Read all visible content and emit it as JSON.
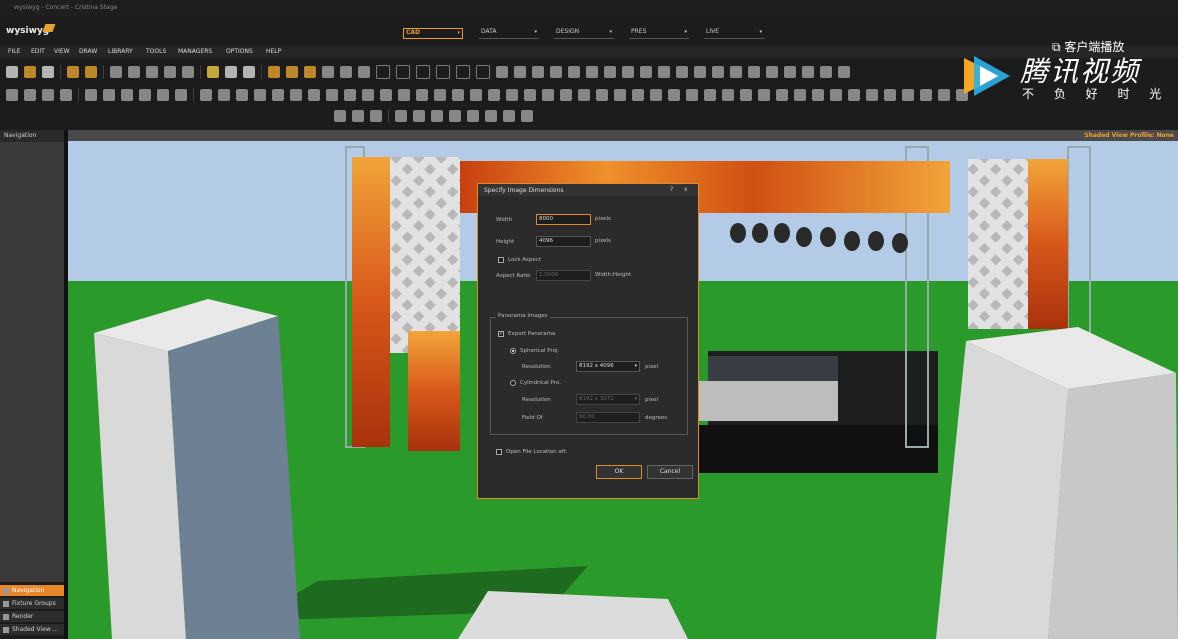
{
  "window": {
    "title": "wysiwyg - Concert - Cristina Stage"
  },
  "app": {
    "logo_text": "wysiwyg"
  },
  "modes": [
    {
      "label": "CAD",
      "active": true
    },
    {
      "label": "DATA",
      "active": false
    },
    {
      "label": "DESIGN",
      "active": false
    },
    {
      "label": "PRES",
      "active": false
    },
    {
      "label": "LIVE",
      "active": false
    }
  ],
  "menu": [
    "FILE",
    "EDIT",
    "VIEW",
    "DRAW",
    "LIBRARY",
    "TOOLS",
    "MANAGERS",
    "OPTIONS",
    "HELP"
  ],
  "navigation": {
    "header": "Navigation",
    "tabs": [
      "Navigation",
      "Fixture Groups",
      "Render",
      "Shaded View ..."
    ]
  },
  "viewport": {
    "profile": "Shaded View Profile: None"
  },
  "watermark": {
    "client_play": "客户端播放",
    "brand": "腾讯视频",
    "slogan": "不 负 好 时 光"
  },
  "dialog": {
    "title": "Specify Image Dimensions",
    "help": "?",
    "close": "x",
    "width_label": "Width",
    "width_value": "8000",
    "height_label": "Height",
    "height_value": "4096",
    "pixels": "pixels",
    "lock_aspect": "Lock Aspect",
    "aspect_ratio_label": "Aspect Ratio",
    "aspect_ratio_value": "1.0000",
    "aspect_ratio_unit": "Width:Height",
    "panorama_group": "Panorama Images",
    "export_panorama": "Export Panorama",
    "spherical": "Spherical Proj.",
    "resolution_label": "Resolution",
    "spherical_resolution": "8192 x 4096",
    "cylindrical": "Cylindrical Pro.",
    "cylindrical_resolution": "8192 x 3072",
    "field_of_view_label": "Field Of",
    "field_of_view_value": "90.00",
    "degrees": "degrees",
    "pixel_unit": "pixel",
    "open_file_location": "Open File Location aft.",
    "ok": "OK",
    "cancel": "Cancel"
  },
  "colors": {
    "accent": "#e8862a",
    "sky": "#b3cbe6",
    "grass": "#2a9a2a"
  }
}
